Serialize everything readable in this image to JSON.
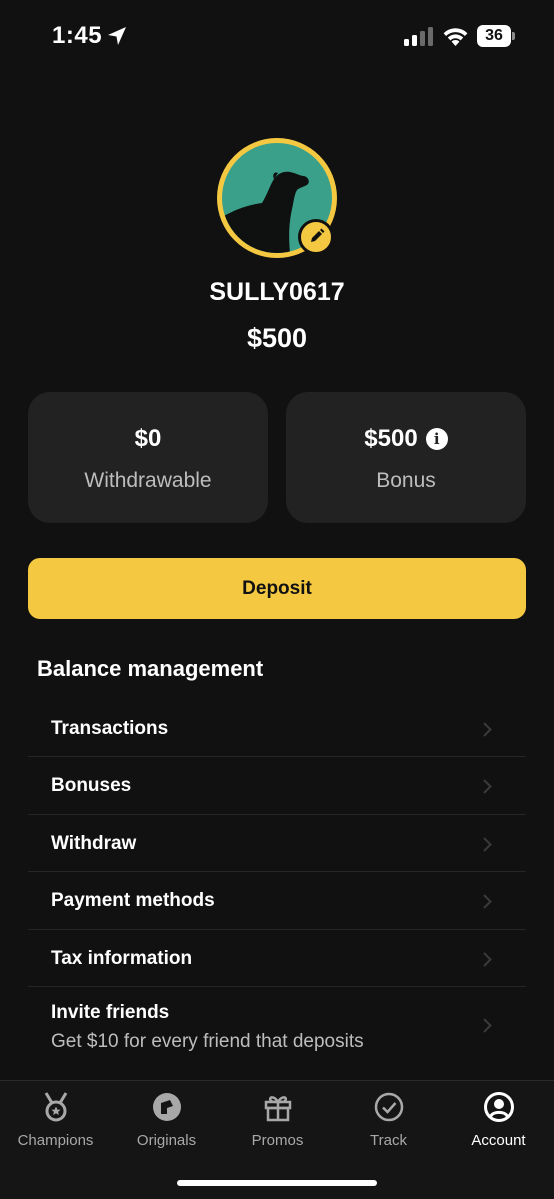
{
  "status_bar": {
    "time": "1:45",
    "battery_level": "36"
  },
  "profile": {
    "username": "SULLY0617",
    "total_balance": "$500"
  },
  "balances": {
    "withdrawable": {
      "amount": "$0",
      "label": "Withdrawable"
    },
    "bonus": {
      "amount": "$500",
      "label": "Bonus"
    }
  },
  "deposit_label": "Deposit",
  "balance_management": {
    "title": "Balance management",
    "items": [
      {
        "label": "Transactions"
      },
      {
        "label": "Bonuses"
      },
      {
        "label": "Withdraw"
      },
      {
        "label": "Payment methods"
      },
      {
        "label": "Tax information"
      },
      {
        "label": "Invite friends",
        "subtitle": "Get $10 for every friend that deposits"
      }
    ]
  },
  "bottom_nav": {
    "items": [
      {
        "label": "Champions",
        "icon": "medal-icon"
      },
      {
        "label": "Originals",
        "icon": "originals-icon"
      },
      {
        "label": "Promos",
        "icon": "gift-icon"
      },
      {
        "label": "Track",
        "icon": "check-circle-icon"
      },
      {
        "label": "Account",
        "icon": "account-icon",
        "active": true
      }
    ]
  },
  "colors": {
    "background": "#111111",
    "card": "#222222",
    "accent": "#f5c842",
    "avatar_bg": "#3aa08a"
  }
}
